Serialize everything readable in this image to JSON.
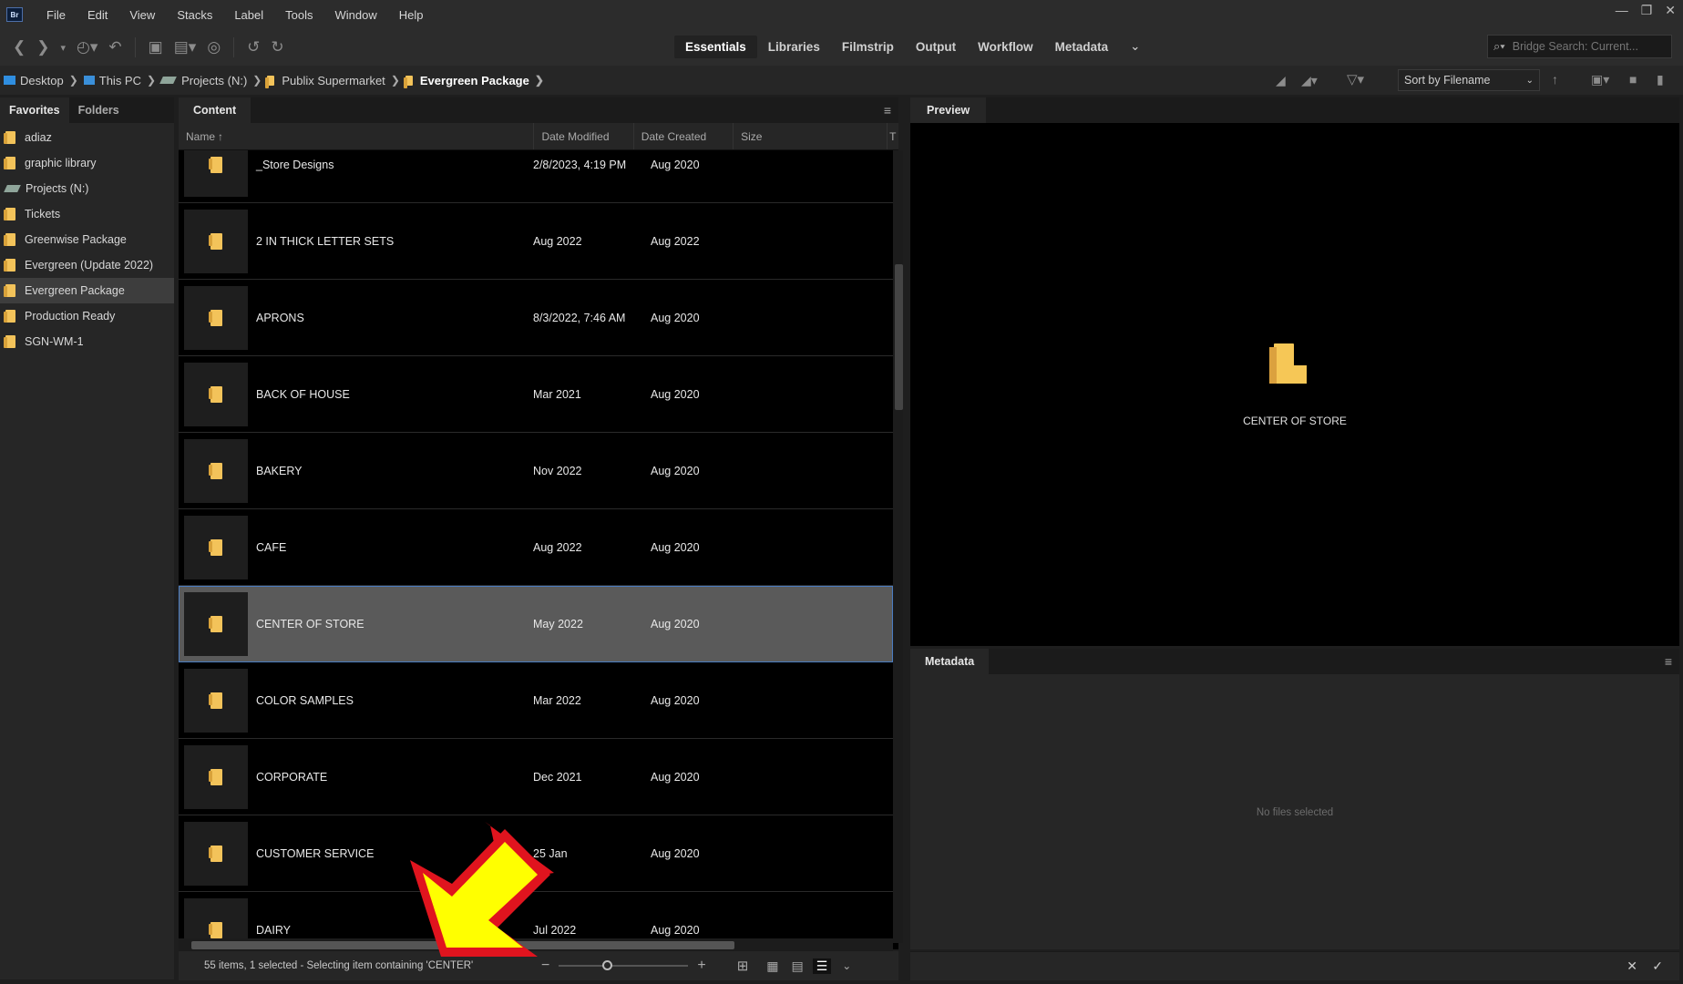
{
  "app": {
    "logo": "Br"
  },
  "menu": [
    "File",
    "Edit",
    "View",
    "Stacks",
    "Label",
    "Tools",
    "Window",
    "Help"
  ],
  "window_controls": {
    "minimize": "—",
    "restore": "❐",
    "close": "✕"
  },
  "workspaces": [
    "Essentials",
    "Libraries",
    "Filmstrip",
    "Output",
    "Workflow",
    "Metadata"
  ],
  "search": {
    "placeholder": "Bridge Search: Current..."
  },
  "breadcrumb": [
    "Desktop",
    "This PC",
    "Projects (N:)",
    "Publix Supermarket",
    "Evergreen Package"
  ],
  "sort": {
    "label": "Sort by Filename"
  },
  "left_panel": {
    "tabs": [
      "Favorites",
      "Folders"
    ],
    "items": [
      {
        "label": "adiaz",
        "icon": "folder-icon"
      },
      {
        "label": "graphic library",
        "icon": "folder-icon"
      },
      {
        "label": "Projects (N:)",
        "icon": "drive-icon"
      },
      {
        "label": "Tickets",
        "icon": "folder-icon"
      },
      {
        "label": "Greenwise Package",
        "icon": "folder-icon"
      },
      {
        "label": "Evergreen (Update 2022)",
        "icon": "folder-icon"
      },
      {
        "label": "Evergreen Package",
        "icon": "folder-icon",
        "selected": true
      },
      {
        "label": "Production Ready",
        "icon": "folder-icon"
      },
      {
        "label": "SGN-WM-1",
        "icon": "folder-icon"
      }
    ]
  },
  "content": {
    "tab": "Content",
    "columns": [
      "Name",
      "Date Modified",
      "Date Created",
      "Size",
      "T"
    ],
    "rows": [
      {
        "name": "_Store Designs",
        "modified": "2/8/2023, 4:19 PM",
        "created": "Aug 2020"
      },
      {
        "name": "2 IN THICK LETTER SETS",
        "modified": "Aug 2022",
        "created": "Aug 2022"
      },
      {
        "name": "APRONS",
        "modified": "8/3/2022, 7:46 AM",
        "created": "Aug 2020"
      },
      {
        "name": "BACK OF HOUSE",
        "modified": "Mar 2021",
        "created": "Aug 2020"
      },
      {
        "name": "BAKERY",
        "modified": "Nov 2022",
        "created": "Aug 2020"
      },
      {
        "name": "CAFE",
        "modified": "Aug 2022",
        "created": "Aug 2020"
      },
      {
        "name": "CENTER OF STORE",
        "modified": "May 2022",
        "created": "Aug 2020",
        "selected": true
      },
      {
        "name": "COLOR SAMPLES",
        "modified": "Mar 2022",
        "created": "Aug 2020"
      },
      {
        "name": "CORPORATE",
        "modified": "Dec 2021",
        "created": "Aug 2020"
      },
      {
        "name": "CUSTOMER SERVICE",
        "modified": "25 Jan",
        "created": "Aug 2020"
      },
      {
        "name": "DAIRY",
        "modified": "Jul 2022",
        "created": "Aug 2020"
      }
    ],
    "status": "55 items, 1 selected - Selecting item containing 'CENTER'"
  },
  "preview": {
    "tab": "Preview",
    "caption": "CENTER OF STORE"
  },
  "metadata": {
    "tab": "Metadata",
    "empty_text": "No files selected"
  },
  "colors": {
    "selection": "#5a5a5a",
    "folder": "#f3c35a",
    "annotation_arrow": "#ffff00",
    "annotation_outline": "#e0141e"
  }
}
